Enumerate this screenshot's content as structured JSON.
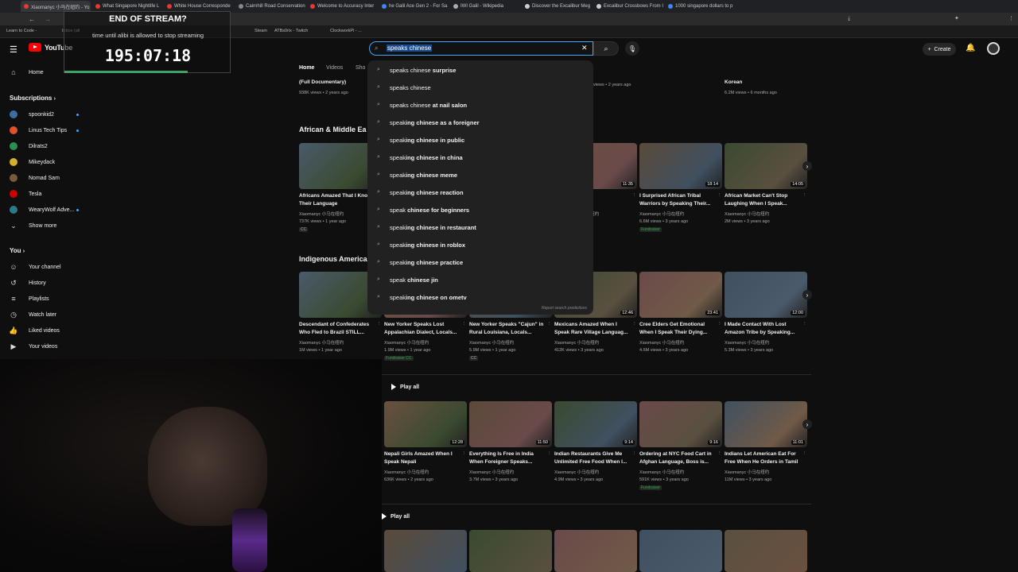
{
  "browser": {
    "tabs": [
      {
        "label": "Xiaomanyc 小马在纽约 - Yo"
      },
      {
        "label": "What Singapore Nightlife L"
      },
      {
        "label": "White House Corresponde"
      },
      {
        "label": "Cairnhill Road Conservation"
      },
      {
        "label": "Welcome to Accuracy Inter"
      },
      {
        "label": "he Galil Ace Gen 2 - For Sa"
      },
      {
        "label": "IWI Galil - Wikipedia"
      },
      {
        "label": "Discover the Excalibur Meg"
      },
      {
        "label": "Excalibur Crossbows From I"
      },
      {
        "label": "1000 singapore dollars to p"
      }
    ],
    "bookmarks": [
      "Learn to Code -",
      "Inbox (all",
      "Steam",
      "ATBs0rix - Twitch",
      "ClockworkPi - ..."
    ]
  },
  "stream_overlay": {
    "title": "END OF STREAM?",
    "subtitle": "time until alibi is allowed to stop streaming",
    "timer": "195:07:18"
  },
  "youtube": {
    "logo_text": "YouTube",
    "search": {
      "value": "speaks chinese"
    },
    "create_label": "Create",
    "channel_tabs": [
      "Home",
      "Videos",
      "Sho"
    ],
    "sidebar": {
      "home": "Home",
      "subscriptions_heading": "Subscriptions",
      "subscriptions": [
        {
          "name": "spoonkid2",
          "color": "#3a6ea5"
        },
        {
          "name": "Linus Tech Tips",
          "color": "#e0512a"
        },
        {
          "name": "Dilrats2",
          "color": "#2f8f4e"
        },
        {
          "name": "Mikeydack",
          "color": "#d4b02a"
        },
        {
          "name": "Nomad Sam",
          "color": "#7a5a3a"
        },
        {
          "name": "Tesla",
          "color": "#cc0000"
        },
        {
          "name": "WearyWolf Adve...",
          "color": "#2a7a8a"
        }
      ],
      "show_more": "Show more",
      "you_heading": "You",
      "you_items": [
        "Your channel",
        "History",
        "Playlists",
        "Watch later",
        "Liked videos",
        "Your videos"
      ]
    },
    "suggestions": {
      "items": [
        {
          "prefix": "speaks chinese",
          "rest": " surprise"
        },
        {
          "prefix": "speaks chinese",
          "rest": ""
        },
        {
          "prefix": "speaks chinese",
          "rest": " at nail salon"
        },
        {
          "prefix": "speak",
          "rest": "ing chinese as a foreigner"
        },
        {
          "prefix": "speak",
          "rest": "ing chinese in public"
        },
        {
          "prefix": "speak",
          "rest": "ing chinese in china"
        },
        {
          "prefix": "speak",
          "rest": "ing chinese meme"
        },
        {
          "prefix": "speak",
          "rest": "ing chinese reaction"
        },
        {
          "prefix": "speak",
          "rest": " chinese for beginners"
        },
        {
          "prefix": "speak",
          "rest": "ing chinese in restaurant"
        },
        {
          "prefix": "speak",
          "rest": "ing chinese in roblox"
        },
        {
          "prefix": "speak",
          "rest": "ing chinese practice"
        },
        {
          "prefix": "speak",
          "rest": " chinese jin"
        },
        {
          "prefix": "speak",
          "rest": "ing chinese on ometv"
        }
      ],
      "report": "Report search predictions"
    },
    "top_row": {
      "left_title": "(Full Documentary)",
      "left_meta": "938K views • 2 years ago",
      "mid_meta": "views • 2 years ago",
      "right_title": "Korean",
      "right_meta": "6.2M views • 6 months ago"
    },
    "sections": {
      "african": "African & Middle Ea",
      "indigenous": "Indigenous America",
      "play_all": "Play all"
    },
    "channel_name": "Xiaomanyc 小马在纽约",
    "row_african": [
      {
        "title": "Africans Amazed That I Kno",
        "title2": "Their Language",
        "meta1": "737K views • 1 year ago",
        "badge": "CC",
        "duration": ""
      },
      {
        "title": "d When I",
        "title2": "guage",
        "meta1": "",
        "badge": "",
        "duration": "11:35"
      },
      {
        "title": "I Surprised African Tribal",
        "title2": "Warriors by Speaking Their...",
        "meta1": "6.6M views • 3 years ago",
        "badge": "Fundraiser",
        "duration": "18:14"
      },
      {
        "title": "African Market Can't Stop",
        "title2": "Laughing When I Speak...",
        "meta1": "2M views • 3 years ago",
        "badge": "",
        "duration": "14:05"
      }
    ],
    "row_indigenous": [
      {
        "title": "Descendant of Confederates",
        "title2": "Who Fled to Brazil STILL...",
        "meta1": "1M views • 1 year ago",
        "badge": "",
        "duration": ""
      },
      {
        "title": "New Yorker Speaks Lost",
        "title2": "Appalachian Dialect, Locals...",
        "meta1": "1.9M views • 1 year ago",
        "badge": "Fundraiser  CC",
        "duration": ""
      },
      {
        "title": "New Yorker Speaks \"Cajun\" in",
        "title2": "Rural Louisiana, Locals...",
        "meta1": "5.9M views • 1 year ago",
        "badge": "CC",
        "duration": ""
      },
      {
        "title": "Mexicans Amazed When I",
        "title2": "Speak Rare Village Languag...",
        "meta1": "412K views • 3 years ago",
        "badge": "",
        "duration": "12:46"
      },
      {
        "title": "Cree Elders Get Emotional",
        "title2": "When I Speak Their Dying...",
        "meta1": "4.6M views • 3 years ago",
        "badge": "",
        "duration": "23:41"
      },
      {
        "title": "I Made Contact With Lost",
        "title2": "Amazon Tribe by Speaking...",
        "meta1": "5.3M views • 3 years ago",
        "badge": "",
        "duration": "12:00"
      }
    ],
    "row_asia": [
      {
        "title": "Nepali Girls Amazed When I",
        "title2": "Speak Nepali",
        "meta1": "636K views • 2 years ago",
        "badge": "",
        "duration": "12:28"
      },
      {
        "title": "Everything Is Free in India",
        "title2": "When Foreigner Speaks...",
        "meta1": "3.7M views • 3 years ago",
        "badge": "",
        "duration": "11:50"
      },
      {
        "title": "Indian Restaurants Give Me",
        "title2": "Unlimited Free Food When I...",
        "meta1": "4.9M views • 3 years ago",
        "badge": "",
        "duration": "9:14"
      },
      {
        "title": "Ordering at NYC Food Cart in",
        "title2": "Afghan Language, Boss is...",
        "meta1": "591K views • 3 years ago",
        "badge": "Fundraiser",
        "duration": "9:16"
      },
      {
        "title": "Indians Let American Eat For",
        "title2": "Free When He Orders in Tamil",
        "meta1": "11M views • 3 years ago",
        "badge": "",
        "duration": "11:01"
      }
    ],
    "thumb_colors": [
      "#4a5a6a",
      "#6a5040",
      "#5a4a3a",
      "#3a4a30",
      "#6a4a4a",
      "#405060",
      "#5a5040",
      "#705a48"
    ]
  }
}
